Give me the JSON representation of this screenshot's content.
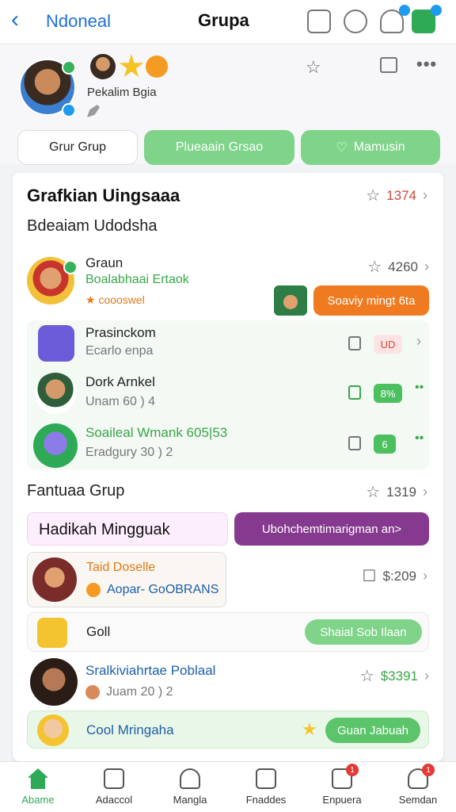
{
  "header": {
    "back_label": "Ndoneal",
    "title": "Grupa",
    "icons": [
      "share-icon",
      "emoji-icon",
      "star-badge-icon",
      "app-icon"
    ]
  },
  "profile": {
    "name": "Pekalim Bgia",
    "tabs": [
      "Grur Grup",
      "Plueaain Grsao",
      "Mamusin"
    ],
    "actions": [
      "star-icon",
      "folder-icon",
      "more-icon"
    ]
  },
  "section1": {
    "title": "Grafkian Uingsaaa",
    "count": "1374",
    "subtitle": "Bdeaiam Udodsha",
    "rows": [
      {
        "title": "Graun",
        "line2": "Boalabhaai Ertaok",
        "line3": "★ coooswel",
        "count": "4260",
        "button": "Soaviy mingt 6ta"
      },
      {
        "title": "Prasinckom",
        "line2": "Ecarlo enpa",
        "tag": "UD"
      },
      {
        "title": "Dork Arnkel",
        "line2": "Unam 60 ) 4",
        "tag": "8%"
      },
      {
        "title": "Soaileal Wmank 605|53",
        "line2": "Eradgury 30 ) 2",
        "tag": "6"
      }
    ]
  },
  "section2": {
    "title": "Fantuaa Grup",
    "count": "1319",
    "highlight": "Hadikah Mingguak",
    "purple_button": "Ubohchemtimarigman an>",
    "rows": [
      {
        "title": "Taid Doselle",
        "line2": "Aopar- GoOBRANS",
        "count": "$:209"
      },
      {
        "title": "Goll",
        "button": "Shaial Sob Ilaan"
      },
      {
        "title": "Sralkiviahrtae Poblaal",
        "line2": "Juam 20 ) 2",
        "count": "$3391"
      },
      {
        "title": "Cool Mringaha",
        "button": "Guan Jabuah"
      }
    ]
  },
  "bottom_nav": [
    {
      "label": "Abame",
      "active": true
    },
    {
      "label": "Adaccol"
    },
    {
      "label": "Mangla"
    },
    {
      "label": "Fnaddes"
    },
    {
      "label": "Enpuera",
      "badge": "1"
    },
    {
      "label": "Semdan",
      "badge": "1"
    }
  ]
}
